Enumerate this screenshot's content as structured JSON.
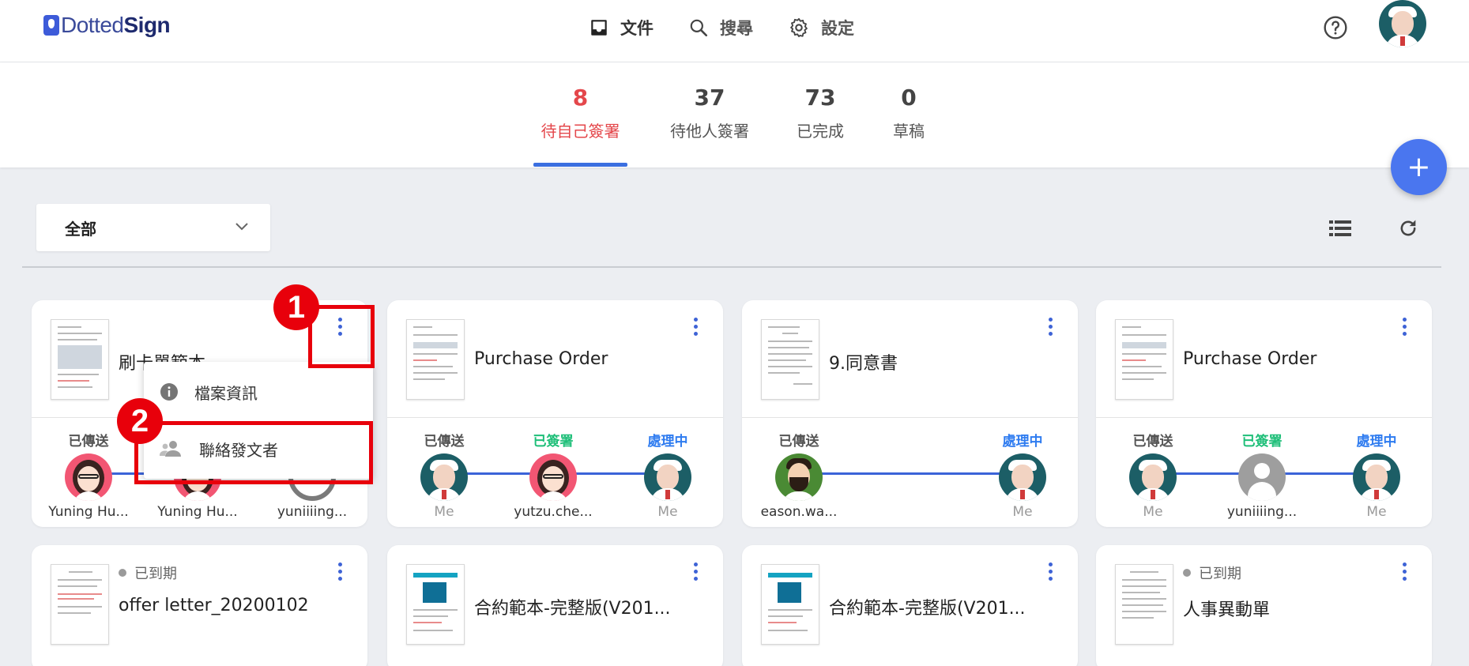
{
  "app": {
    "logo_light": "Dotted",
    "logo_bold": "Sign"
  },
  "nav": {
    "documents": "文件",
    "search": "搜尋",
    "settings": "設定"
  },
  "tabs": [
    {
      "count": "8",
      "label": "待自己簽署"
    },
    {
      "count": "37",
      "label": "待他人簽署"
    },
    {
      "count": "73",
      "label": "已完成"
    },
    {
      "count": "0",
      "label": "草稿"
    }
  ],
  "fab_label": "+",
  "filter": {
    "selected": "全部"
  },
  "cards": [
    {
      "title": "刷卡單範本",
      "steps": [
        {
          "status": "已傳送",
          "name": "Yuning Hu..."
        },
        {
          "status": "",
          "name": "Yuning Hu..."
        },
        {
          "status": "",
          "name": "yuniiiing..."
        }
      ]
    },
    {
      "title": "Purchase Order",
      "steps": [
        {
          "status": "已傳送",
          "name": "Me"
        },
        {
          "status": "已簽署",
          "name": "yutzu.che..."
        },
        {
          "status": "處理中",
          "name": "Me"
        }
      ]
    },
    {
      "title": "9.同意書",
      "steps": [
        {
          "status": "已傳送",
          "name": "eason.wa..."
        },
        {
          "status": "處理中",
          "name": "Me"
        }
      ]
    },
    {
      "title": "Purchase Order",
      "steps": [
        {
          "status": "已傳送",
          "name": "Me"
        },
        {
          "status": "已簽署",
          "name": "yuniiiing..."
        },
        {
          "status": "處理中",
          "name": "Me"
        }
      ]
    },
    {
      "title": "offer letter_20200102",
      "status": "已到期"
    },
    {
      "title": "合約範本-完整版(V201..."
    },
    {
      "title": "合約範本-完整版(V201..."
    },
    {
      "title": "人事異動單",
      "status": "已到期"
    }
  ],
  "context_menu": {
    "items": [
      {
        "label": "檔案資訊"
      },
      {
        "label": "聯絡發文者"
      }
    ]
  },
  "annotations": {
    "badge1": "1",
    "badge2": "2"
  }
}
